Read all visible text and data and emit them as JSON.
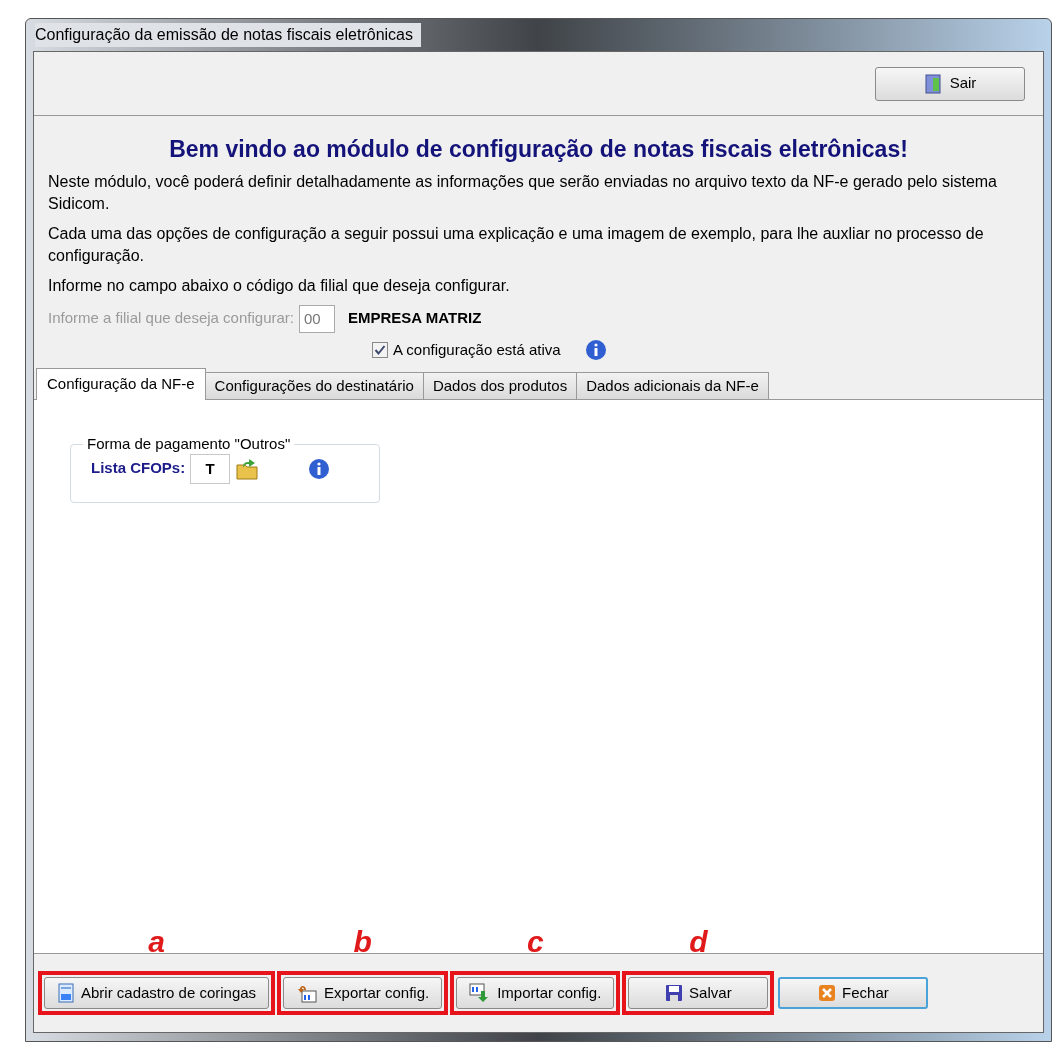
{
  "window": {
    "title": "Configuração da emissão de notas fiscais eletrônicas"
  },
  "toolbar": {
    "exit_button": "Sair"
  },
  "heading": "Bem vindo ao módulo de configuração de notas fiscais eletrônicas!",
  "paragraphs": [
    "Neste módulo, você poderá definir detalhadamente as informações que serão enviadas no arquivo texto da NF-e gerado pelo sistema Sidicom.",
    "Cada uma das opções de configuração a seguir possui uma explicação e uma imagem de exemplo, para lhe auxliar no processo de configuração.",
    "Informe no campo abaixo o código da filial que deseja configurar."
  ],
  "branch": {
    "label": "Informe a filial que deseja configurar:",
    "value": "00",
    "name": "EMPRESA MATRIZ",
    "disabled": true
  },
  "active_checkbox": {
    "label": "A configuração está ativa",
    "checked": true
  },
  "tabs": [
    {
      "label": "Configuração da NF-e",
      "selected": true
    },
    {
      "label": "Configurações do destinatário",
      "selected": false
    },
    {
      "label": "Dados dos produtos",
      "selected": false
    },
    {
      "label": "Dados adicionais da NF-e",
      "selected": false
    }
  ],
  "group": {
    "title": "Forma de pagamento \"Outros\"",
    "field_label": "Lista CFOPs:",
    "field_value": "T"
  },
  "buttons": [
    {
      "label": "Abrir cadastro de coringas",
      "kind": "wildcards",
      "annotation": "a"
    },
    {
      "label": "Exportar config.",
      "kind": "export",
      "annotation": "b"
    },
    {
      "label": "Importar config.",
      "kind": "import",
      "annotation": "c"
    },
    {
      "label": "Salvar",
      "kind": "save",
      "annotation": "d"
    },
    {
      "label": "Fechar",
      "kind": "close"
    }
  ]
}
